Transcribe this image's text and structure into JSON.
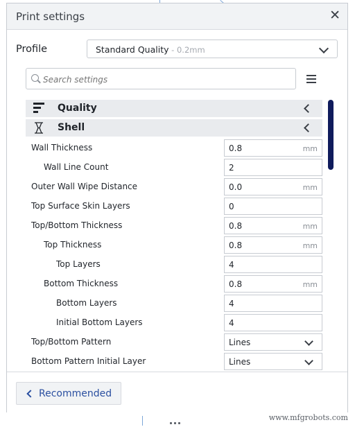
{
  "window": {
    "title": "Print settings"
  },
  "profile": {
    "label": "Profile",
    "value": "Standard Quality",
    "sub": " - 0.2mm"
  },
  "search": {
    "placeholder": "Search settings"
  },
  "categories": [
    {
      "name": "Quality",
      "icon": "quality-icon"
    },
    {
      "name": "Shell",
      "icon": "shell-icon"
    }
  ],
  "settings": [
    {
      "label": "Wall Thickness",
      "value": "0.8",
      "unit": "mm",
      "type": "number"
    },
    {
      "label": "Wall Line Count",
      "value": "2",
      "unit": "",
      "type": "number"
    },
    {
      "label": "Outer Wall Wipe Distance",
      "value": "0.0",
      "unit": "mm",
      "type": "number"
    },
    {
      "label": "Top Surface Skin Layers",
      "value": "0",
      "unit": "",
      "type": "number"
    },
    {
      "label": "Top/Bottom Thickness",
      "value": "0.8",
      "unit": "mm",
      "type": "number"
    },
    {
      "label": "Top Thickness",
      "value": "0.8",
      "unit": "mm",
      "type": "number"
    },
    {
      "label": "Top Layers",
      "value": "4",
      "unit": "",
      "type": "number"
    },
    {
      "label": "Bottom Thickness",
      "value": "0.8",
      "unit": "mm",
      "type": "number"
    },
    {
      "label": "Bottom Layers",
      "value": "4",
      "unit": "",
      "type": "number"
    },
    {
      "label": "Initial Bottom Layers",
      "value": "4",
      "unit": "",
      "type": "number"
    },
    {
      "label": "Top/Bottom Pattern",
      "value": "Lines",
      "unit": "",
      "type": "select"
    },
    {
      "label": "Bottom Pattern Initial Layer",
      "value": "Lines",
      "unit": "",
      "type": "select"
    }
  ],
  "footer": {
    "recommended_label": "Recommended"
  },
  "watermark": "www.mfgrobots.com",
  "colors": {
    "accent": "#2a4fa0",
    "scrollbar": "#0f1b5c",
    "category_bg": "#e9ebee"
  }
}
